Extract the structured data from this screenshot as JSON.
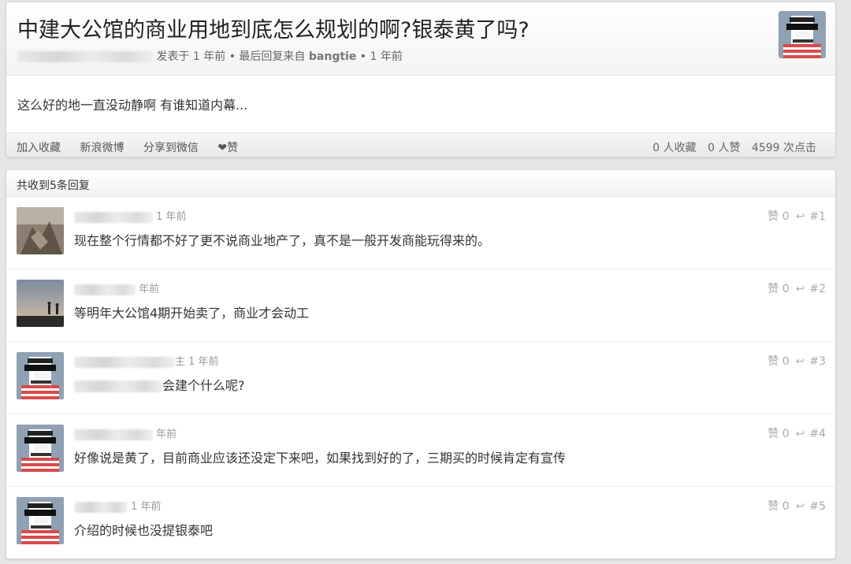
{
  "topic": {
    "title": "中建大公馆的商业用地到底怎么规划的啊?银泰黄了吗?",
    "posted_label": "发表于 1 年前",
    "last_reply_label": "• 最后回复来自",
    "last_reply_user": "bangtie",
    "last_reply_time": "• 1 年前",
    "body": "这么好的地一直没动静啊 有谁知道内幕...",
    "actions": {
      "favorite": "加入收藏",
      "weibo": "新浪微博",
      "wechat": "分享到微信",
      "like": "❤赞"
    },
    "stats": {
      "favorites": "0 人收藏",
      "likes": "0 人赞",
      "clicks": "4599 次点击"
    }
  },
  "replies_header": "共收到5条回复",
  "replies": [
    {
      "time": "1 年前",
      "text": "现在整个行情都不好了更不说商业地产了，真不是一般开发商能玩得来的。",
      "likes": "赞 0",
      "floor": "#1",
      "avatar": "blurred-photo"
    },
    {
      "time": "年前",
      "text": "等明年大公馆4期开始卖了，商业才会动工",
      "likes": "赞 0",
      "floor": "#2",
      "avatar": "sunset-runner-photo"
    },
    {
      "time": "1 年前",
      "prefix": "主",
      "text": "会建个什么呢?",
      "likes": "赞 0",
      "floor": "#3",
      "avatar": "pixel-sunglasses-avatar"
    },
    {
      "time": "年前",
      "text": "好像说是黄了，目前商业应该还没定下来吧，如果找到好的了，三期买的时候肯定有宣传",
      "likes": "赞 0",
      "floor": "#4",
      "avatar": "pixel-sunglasses-avatar"
    },
    {
      "time": "1 年前",
      "text": "介绍的时候也没提银泰吧",
      "likes": "赞 0",
      "floor": "#5",
      "avatar": "pixel-sunglasses-avatar"
    }
  ]
}
